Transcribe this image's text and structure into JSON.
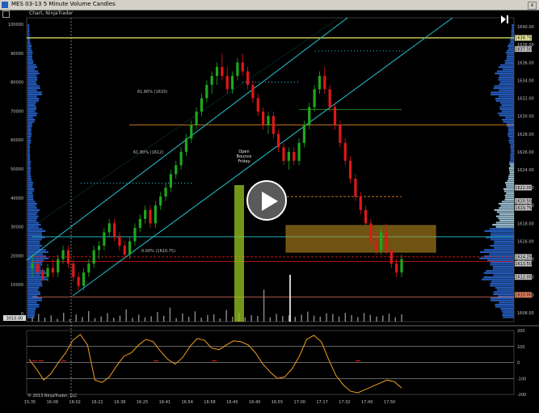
{
  "window": {
    "title": "MES 03-13 5 Minute Volume Candles",
    "close_label": "x"
  },
  "toolbar": {
    "instrument_label": "Chart, NinjaTrader"
  },
  "colors": {
    "up_candle": "#1ea81e",
    "down_candle": "#e01818",
    "channel": "#26c6d0",
    "fib_orange": "#e08020",
    "dotted_cyan": "#20b0c0",
    "oscillator": "#f0a020",
    "value_area_box": "#c89820",
    "volume_bar": "#8a8a8a"
  },
  "price_axis": {
    "labels": [
      "1640.00",
      "1638.00",
      "1636.00",
      "1634.00",
      "1632.00",
      "1630.00",
      "1628.00",
      "1626.00",
      "1624.00",
      "1622.00",
      "1620.00",
      "1618.00",
      "1616.00",
      "1614.00",
      "1612.00",
      "1610.00",
      "1608.00"
    ],
    "tags": [
      {
        "text": "1638.75",
        "color": "#e8e8a0"
      },
      {
        "text": "1637.50",
        "color": "#c0c0c0"
      },
      {
        "text": "1622.00",
        "color": "#c0c0c0"
      },
      {
        "text": "1620.50",
        "color": "#c0c0c0"
      },
      {
        "text": "1619.75",
        "color": "#c0c0c0"
      },
      {
        "text": "1614.25",
        "color": "#c0c0c0"
      },
      {
        "text": "1613.50",
        "color": "#c0c0c0"
      },
      {
        "text": "1612.00",
        "color": "#c0c0c0"
      },
      {
        "text": "1610.00",
        "color": "#e08060"
      }
    ]
  },
  "left_volume_axis": {
    "labels": [
      "100000",
      "90000",
      "80000",
      "70000",
      "60000",
      "50000",
      "40000",
      "30000",
      "20000",
      "10000",
      "0"
    ],
    "badge": "3010.00"
  },
  "oscillator_axis": {
    "labels": [
      "200",
      "100",
      "0",
      "-100",
      "-200"
    ]
  },
  "time_axis": {
    "labels": [
      "15:35",
      "16:08",
      "16:02",
      "16:22",
      "16:38",
      "16:25",
      "16:41",
      "16:54",
      "16:58",
      "16:40",
      "16:40",
      "16:55",
      "17:00",
      "17:17",
      "17:32",
      "17:40",
      "17:50"
    ]
  },
  "annotations": {
    "fib_618_upper": "61.80% (1633)",
    "fib_618_mid": "61.80% (1612)",
    "fib_low": "0.00% (1610.75)",
    "open_note_line1": "Open",
    "open_note_line2": "Bounce",
    "open_note_line3": "Friday"
  },
  "footer": {
    "copyright": "© 2013 NinjaTrader, LLC"
  },
  "chart_data": [
    {
      "type": "candlestick",
      "title": "MES 03-13 5 Minute Volume Candles",
      "xlabel": "",
      "ylabel": "",
      "ylim": [
        1607,
        1641
      ],
      "grid": false,
      "ohlc": [
        [
          1613.0,
          1614.5,
          1612.0,
          1613.5
        ],
        [
          1613.5,
          1614.0,
          1612.0,
          1612.5
        ],
        [
          1612.5,
          1613.0,
          1611.5,
          1612.0
        ],
        [
          1612.0,
          1613.5,
          1611.5,
          1613.0
        ],
        [
          1613.0,
          1614.0,
          1612.0,
          1612.5
        ],
        [
          1612.5,
          1614.5,
          1612.0,
          1614.0
        ],
        [
          1614.0,
          1615.5,
          1613.5,
          1615.0
        ],
        [
          1615.0,
          1615.5,
          1613.0,
          1613.5
        ],
        [
          1613.5,
          1614.0,
          1611.5,
          1612.0
        ],
        [
          1612.0,
          1612.5,
          1610.5,
          1611.0
        ],
        [
          1611.0,
          1613.0,
          1610.5,
          1612.5
        ],
        [
          1612.5,
          1614.0,
          1612.0,
          1613.5
        ],
        [
          1613.5,
          1615.5,
          1613.0,
          1615.0
        ],
        [
          1615.0,
          1616.0,
          1614.0,
          1615.5
        ],
        [
          1615.5,
          1617.5,
          1615.0,
          1617.0
        ],
        [
          1617.0,
          1618.5,
          1616.5,
          1618.0
        ],
        [
          1618.0,
          1618.5,
          1616.0,
          1616.5
        ],
        [
          1616.5,
          1617.0,
          1615.0,
          1615.5
        ],
        [
          1615.5,
          1616.0,
          1614.0,
          1614.5
        ],
        [
          1614.5,
          1616.5,
          1614.0,
          1616.0
        ],
        [
          1616.0,
          1618.0,
          1615.5,
          1617.5
        ],
        [
          1617.5,
          1619.0,
          1617.0,
          1618.5
        ],
        [
          1618.5,
          1620.0,
          1618.0,
          1619.5
        ],
        [
          1619.5,
          1620.0,
          1617.5,
          1618.0
        ],
        [
          1618.0,
          1620.5,
          1617.5,
          1620.0
        ],
        [
          1620.0,
          1621.5,
          1619.5,
          1621.0
        ],
        [
          1621.0,
          1622.5,
          1620.5,
          1622.0
        ],
        [
          1622.0,
          1624.0,
          1621.5,
          1623.5
        ],
        [
          1623.5,
          1625.0,
          1623.0,
          1624.5
        ],
        [
          1624.5,
          1626.5,
          1624.0,
          1626.0
        ],
        [
          1626.0,
          1628.0,
          1625.5,
          1627.5
        ],
        [
          1627.5,
          1629.5,
          1627.0,
          1629.0
        ],
        [
          1629.0,
          1631.0,
          1628.5,
          1630.5
        ],
        [
          1630.5,
          1632.5,
          1630.0,
          1632.0
        ],
        [
          1632.0,
          1634.0,
          1631.5,
          1633.5
        ],
        [
          1633.5,
          1635.0,
          1632.5,
          1634.5
        ],
        [
          1634.5,
          1636.0,
          1633.5,
          1635.5
        ],
        [
          1635.5,
          1637.0,
          1634.0,
          1634.5
        ],
        [
          1634.5,
          1635.5,
          1632.5,
          1633.0
        ],
        [
          1633.0,
          1635.0,
          1632.5,
          1634.5
        ],
        [
          1634.5,
          1636.5,
          1634.0,
          1636.0
        ],
        [
          1636.0,
          1637.0,
          1634.5,
          1635.0
        ],
        [
          1635.0,
          1635.5,
          1633.0,
          1633.5
        ],
        [
          1633.5,
          1634.0,
          1631.5,
          1632.0
        ],
        [
          1632.0,
          1632.5,
          1630.0,
          1630.5
        ],
        [
          1630.5,
          1631.0,
          1628.5,
          1629.0
        ],
        [
          1629.0,
          1630.5,
          1628.0,
          1630.0
        ],
        [
          1630.0,
          1630.5,
          1627.5,
          1628.0
        ],
        [
          1628.0,
          1628.5,
          1626.0,
          1626.5
        ],
        [
          1626.5,
          1627.0,
          1624.5,
          1625.0
        ],
        [
          1625.0,
          1626.5,
          1624.0,
          1626.0
        ],
        [
          1626.0,
          1626.5,
          1624.5,
          1625.0
        ],
        [
          1625.0,
          1627.5,
          1624.5,
          1627.0
        ],
        [
          1627.0,
          1629.5,
          1626.5,
          1629.0
        ],
        [
          1629.0,
          1631.5,
          1628.5,
          1631.0
        ],
        [
          1631.0,
          1633.5,
          1630.5,
          1633.0
        ],
        [
          1633.0,
          1635.0,
          1632.5,
          1634.5
        ],
        [
          1634.5,
          1635.5,
          1632.5,
          1633.0
        ],
        [
          1633.0,
          1633.5,
          1630.5,
          1631.0
        ],
        [
          1631.0,
          1631.5,
          1628.5,
          1629.0
        ],
        [
          1629.0,
          1629.5,
          1626.5,
          1627.0
        ],
        [
          1627.0,
          1627.5,
          1624.5,
          1625.0
        ],
        [
          1625.0,
          1625.5,
          1622.5,
          1623.0
        ],
        [
          1623.0,
          1623.5,
          1620.5,
          1621.0
        ],
        [
          1621.0,
          1621.5,
          1619.0,
          1619.5
        ],
        [
          1619.5,
          1620.0,
          1617.5,
          1618.0
        ],
        [
          1618.0,
          1618.5,
          1615.5,
          1616.0
        ],
        [
          1616.0,
          1617.0,
          1614.5,
          1615.0
        ],
        [
          1615.0,
          1617.5,
          1614.5,
          1617.0
        ],
        [
          1617.0,
          1618.0,
          1614.5,
          1615.0
        ],
        [
          1615.0,
          1615.5,
          1613.0,
          1613.5
        ],
        [
          1613.5,
          1614.0,
          1612.0,
          1612.5
        ],
        [
          1612.5,
          1614.5,
          1612.0,
          1614.0
        ]
      ],
      "bid_ask_profile_levels_note": "",
      "channels": [
        {
          "name": "",
          "from": [
            1612.0,
            1636.0
          ]
        },
        {
          "name": "",
          "from": [
            1608.5,
            1632.5
          ]
        }
      ],
      "horizontal_levels": [
        {
          "price": 1638.75,
          "color": "#e8e860",
          "style": "solid"
        },
        {
          "price": 1629.0,
          "color": "#e08020",
          "style": "solid"
        },
        {
          "price": 1621.0,
          "color": "#e08020",
          "style": "dashed"
        },
        {
          "price": 1616.5,
          "color": "#26c6d0",
          "style": "solid"
        },
        {
          "price": 1614.25,
          "color": "#e01818",
          "style": "dashed"
        },
        {
          "price": 1613.75,
          "color": "#e01818",
          "style": "solid"
        },
        {
          "price": 1609.75,
          "color": "#e07060",
          "style": "solid"
        },
        {
          "price": 1630.75,
          "color": "#1ea81e",
          "style": "solid"
        }
      ]
    },
    {
      "type": "bar",
      "title": "",
      "xlabel": "",
      "ylabel": "",
      "ylim": [
        0,
        100000
      ],
      "values": [
        5200,
        8000,
        4200,
        6500,
        3000,
        9200,
        2500,
        7400,
        4800,
        11000,
        3600,
        5500,
        8800,
        4000,
        6300,
        12500,
        3900,
        7200,
        4400,
        5600,
        9800,
        6100,
        14500,
        3700,
        8400,
        5000,
        10600,
        4100,
        6900,
        7700,
        3300,
        12000,
        5200,
        9000,
        4300,
        6800,
        5900,
        33000,
        4600,
        8200,
        5700,
        6600,
        4900,
        7300,
        10400,
        6200,
        5100,
        8600,
        7900,
        5300,
        9100,
        6700,
        4700,
        8900,
        7000,
        5400,
        6400,
        8300,
        4500,
        7600
      ]
    },
    {
      "type": "line",
      "title": "",
      "xlabel": "",
      "ylabel": "",
      "ylim": [
        -200,
        200
      ],
      "values": [
        20,
        -40,
        -110,
        -70,
        0,
        60,
        140,
        175,
        110,
        -110,
        -125,
        -90,
        -20,
        40,
        60,
        110,
        145,
        130,
        70,
        20,
        -10,
        30,
        100,
        150,
        140,
        90,
        80,
        110,
        135,
        130,
        110,
        60,
        -10,
        -60,
        -100,
        -90,
        -40,
        40,
        145,
        170,
        130,
        20,
        -80,
        -140,
        -180,
        -190,
        -170,
        -150,
        -130,
        -110,
        -120,
        -160
      ]
    }
  ]
}
